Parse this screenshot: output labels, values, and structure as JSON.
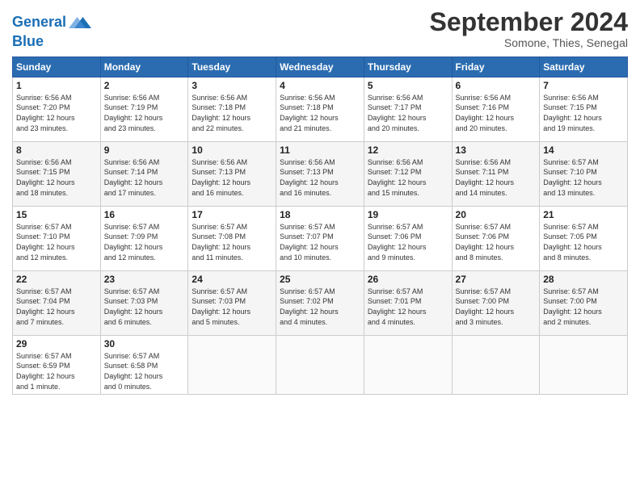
{
  "header": {
    "logo_line1": "General",
    "logo_line2": "Blue",
    "month": "September 2024",
    "location": "Somone, Thies, Senegal"
  },
  "weekdays": [
    "Sunday",
    "Monday",
    "Tuesday",
    "Wednesday",
    "Thursday",
    "Friday",
    "Saturday"
  ],
  "weeks": [
    [
      {
        "day": "1",
        "info": "Sunrise: 6:56 AM\nSunset: 7:20 PM\nDaylight: 12 hours\nand 23 minutes."
      },
      {
        "day": "2",
        "info": "Sunrise: 6:56 AM\nSunset: 7:19 PM\nDaylight: 12 hours\nand 23 minutes."
      },
      {
        "day": "3",
        "info": "Sunrise: 6:56 AM\nSunset: 7:18 PM\nDaylight: 12 hours\nand 22 minutes."
      },
      {
        "day": "4",
        "info": "Sunrise: 6:56 AM\nSunset: 7:18 PM\nDaylight: 12 hours\nand 21 minutes."
      },
      {
        "day": "5",
        "info": "Sunrise: 6:56 AM\nSunset: 7:17 PM\nDaylight: 12 hours\nand 20 minutes."
      },
      {
        "day": "6",
        "info": "Sunrise: 6:56 AM\nSunset: 7:16 PM\nDaylight: 12 hours\nand 20 minutes."
      },
      {
        "day": "7",
        "info": "Sunrise: 6:56 AM\nSunset: 7:15 PM\nDaylight: 12 hours\nand 19 minutes."
      }
    ],
    [
      {
        "day": "8",
        "info": "Sunrise: 6:56 AM\nSunset: 7:15 PM\nDaylight: 12 hours\nand 18 minutes."
      },
      {
        "day": "9",
        "info": "Sunrise: 6:56 AM\nSunset: 7:14 PM\nDaylight: 12 hours\nand 17 minutes."
      },
      {
        "day": "10",
        "info": "Sunrise: 6:56 AM\nSunset: 7:13 PM\nDaylight: 12 hours\nand 16 minutes."
      },
      {
        "day": "11",
        "info": "Sunrise: 6:56 AM\nSunset: 7:13 PM\nDaylight: 12 hours\nand 16 minutes."
      },
      {
        "day": "12",
        "info": "Sunrise: 6:56 AM\nSunset: 7:12 PM\nDaylight: 12 hours\nand 15 minutes."
      },
      {
        "day": "13",
        "info": "Sunrise: 6:56 AM\nSunset: 7:11 PM\nDaylight: 12 hours\nand 14 minutes."
      },
      {
        "day": "14",
        "info": "Sunrise: 6:57 AM\nSunset: 7:10 PM\nDaylight: 12 hours\nand 13 minutes."
      }
    ],
    [
      {
        "day": "15",
        "info": "Sunrise: 6:57 AM\nSunset: 7:10 PM\nDaylight: 12 hours\nand 12 minutes."
      },
      {
        "day": "16",
        "info": "Sunrise: 6:57 AM\nSunset: 7:09 PM\nDaylight: 12 hours\nand 12 minutes."
      },
      {
        "day": "17",
        "info": "Sunrise: 6:57 AM\nSunset: 7:08 PM\nDaylight: 12 hours\nand 11 minutes."
      },
      {
        "day": "18",
        "info": "Sunrise: 6:57 AM\nSunset: 7:07 PM\nDaylight: 12 hours\nand 10 minutes."
      },
      {
        "day": "19",
        "info": "Sunrise: 6:57 AM\nSunset: 7:06 PM\nDaylight: 12 hours\nand 9 minutes."
      },
      {
        "day": "20",
        "info": "Sunrise: 6:57 AM\nSunset: 7:06 PM\nDaylight: 12 hours\nand 8 minutes."
      },
      {
        "day": "21",
        "info": "Sunrise: 6:57 AM\nSunset: 7:05 PM\nDaylight: 12 hours\nand 8 minutes."
      }
    ],
    [
      {
        "day": "22",
        "info": "Sunrise: 6:57 AM\nSunset: 7:04 PM\nDaylight: 12 hours\nand 7 minutes."
      },
      {
        "day": "23",
        "info": "Sunrise: 6:57 AM\nSunset: 7:03 PM\nDaylight: 12 hours\nand 6 minutes."
      },
      {
        "day": "24",
        "info": "Sunrise: 6:57 AM\nSunset: 7:03 PM\nDaylight: 12 hours\nand 5 minutes."
      },
      {
        "day": "25",
        "info": "Sunrise: 6:57 AM\nSunset: 7:02 PM\nDaylight: 12 hours\nand 4 minutes."
      },
      {
        "day": "26",
        "info": "Sunrise: 6:57 AM\nSunset: 7:01 PM\nDaylight: 12 hours\nand 4 minutes."
      },
      {
        "day": "27",
        "info": "Sunrise: 6:57 AM\nSunset: 7:00 PM\nDaylight: 12 hours\nand 3 minutes."
      },
      {
        "day": "28",
        "info": "Sunrise: 6:57 AM\nSunset: 7:00 PM\nDaylight: 12 hours\nand 2 minutes."
      }
    ],
    [
      {
        "day": "29",
        "info": "Sunrise: 6:57 AM\nSunset: 6:59 PM\nDaylight: 12 hours\nand 1 minute."
      },
      {
        "day": "30",
        "info": "Sunrise: 6:57 AM\nSunset: 6:58 PM\nDaylight: 12 hours\nand 0 minutes."
      },
      {
        "day": "",
        "info": ""
      },
      {
        "day": "",
        "info": ""
      },
      {
        "day": "",
        "info": ""
      },
      {
        "day": "",
        "info": ""
      },
      {
        "day": "",
        "info": ""
      }
    ]
  ]
}
